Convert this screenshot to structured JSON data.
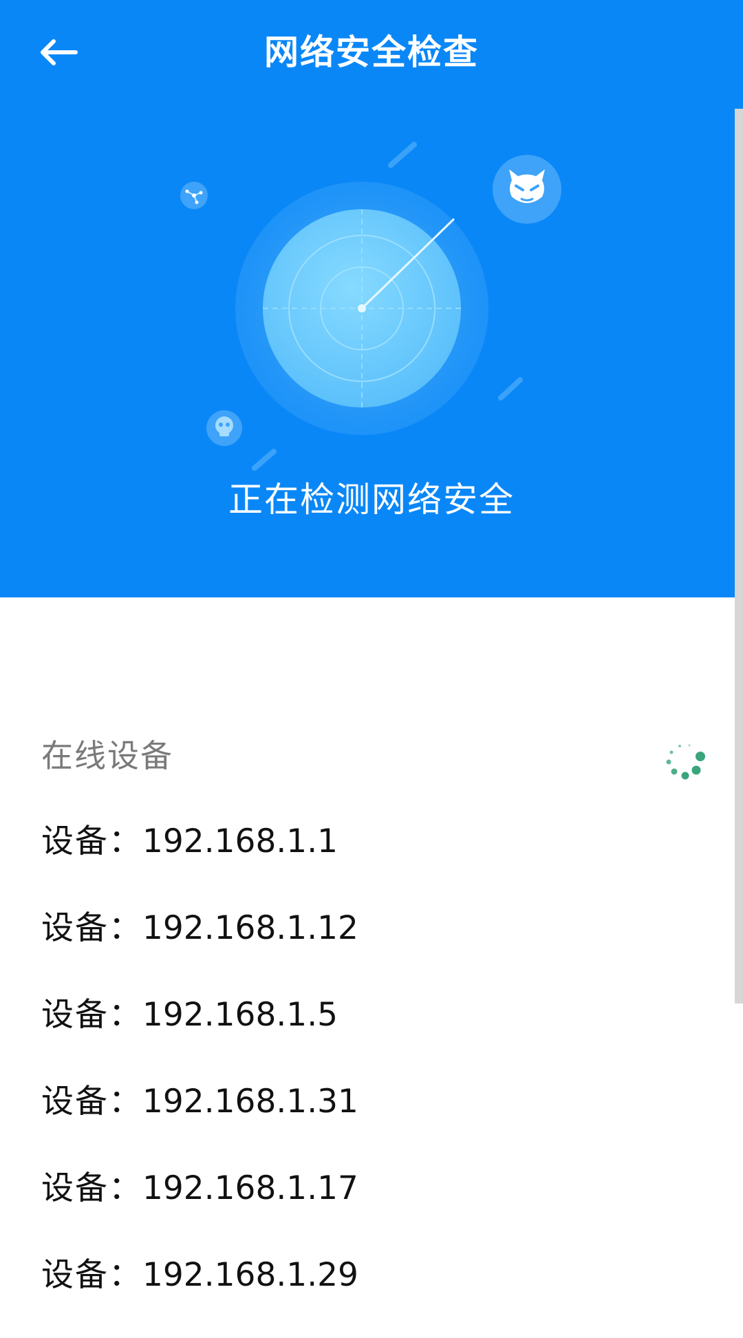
{
  "app": {
    "title": "网络安全检查",
    "back_icon": "arrow-left-icon"
  },
  "scan": {
    "status_text": "正在检测网络安全",
    "icons": [
      "radar-icon",
      "devil-icon",
      "skull-icon",
      "network-node-icon"
    ]
  },
  "online_devices": {
    "section_title": "在线设备",
    "spinner_icon": "loading-spinner-icon",
    "spinner_color": "#3aa57a",
    "items": [
      {
        "label": "设备：",
        "ip": "192.168.1.1"
      },
      {
        "label": "设备：",
        "ip": "192.168.1.12"
      },
      {
        "label": "设备：",
        "ip": "192.168.1.5"
      },
      {
        "label": "设备：",
        "ip": "192.168.1.31"
      },
      {
        "label": "设备：",
        "ip": "192.168.1.17"
      },
      {
        "label": "设备：",
        "ip": "192.168.1.29"
      }
    ]
  },
  "colors": {
    "header_background": "#0a87f7",
    "radar_inner": "#62c6fb",
    "text_primary": "#111111",
    "text_secondary": "#7a7a7a"
  }
}
